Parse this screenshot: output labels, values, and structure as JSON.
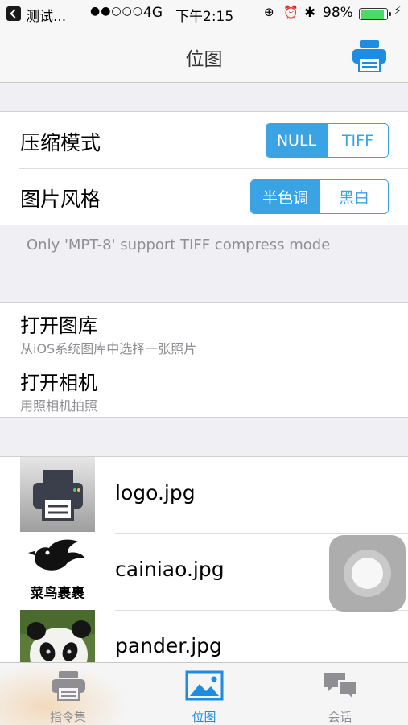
{
  "status_bar": {
    "app_back_label": "测试...",
    "carrier_signal": "●●○○○",
    "network": "4G",
    "time": "下午2:15",
    "battery_percent": "98%",
    "battery_level": 0.98
  },
  "nav": {
    "title": "位图",
    "print_icon": "printer-icon"
  },
  "settings": {
    "compress_label": "压缩模式",
    "compress_options": [
      "NULL",
      "TIFF"
    ],
    "compress_selected": "NULL",
    "style_label": "图片风格",
    "style_options": [
      "半色调",
      "黑白"
    ],
    "style_selected": "半色调",
    "footnote": "Only 'MPT-8' support TIFF compress mode"
  },
  "sources": [
    {
      "title": "打开图库",
      "subtitle": "从iOS系统图库中选择一张照片"
    },
    {
      "title": "打开相机",
      "subtitle": "用照相机拍照"
    }
  ],
  "images": [
    {
      "name": "logo.jpg",
      "thumb": "printer-thumbnail"
    },
    {
      "name": "cainiao.jpg",
      "thumb": "cainiao-logo-thumbnail",
      "logo_text": "菜鸟裹裹"
    },
    {
      "name": "pander.jpg",
      "thumb": "panda-photo-thumbnail"
    }
  ],
  "tabs": [
    {
      "label": "指令集",
      "icon": "printer-icon",
      "active": false
    },
    {
      "label": "位图",
      "icon": "image-icon",
      "active": true
    },
    {
      "label": "会话",
      "icon": "chat-bubbles-icon",
      "active": false
    }
  ],
  "colors": {
    "accent": "#3aa3e3",
    "tab_active": "#1e8ce0",
    "battery": "#4cd964"
  }
}
